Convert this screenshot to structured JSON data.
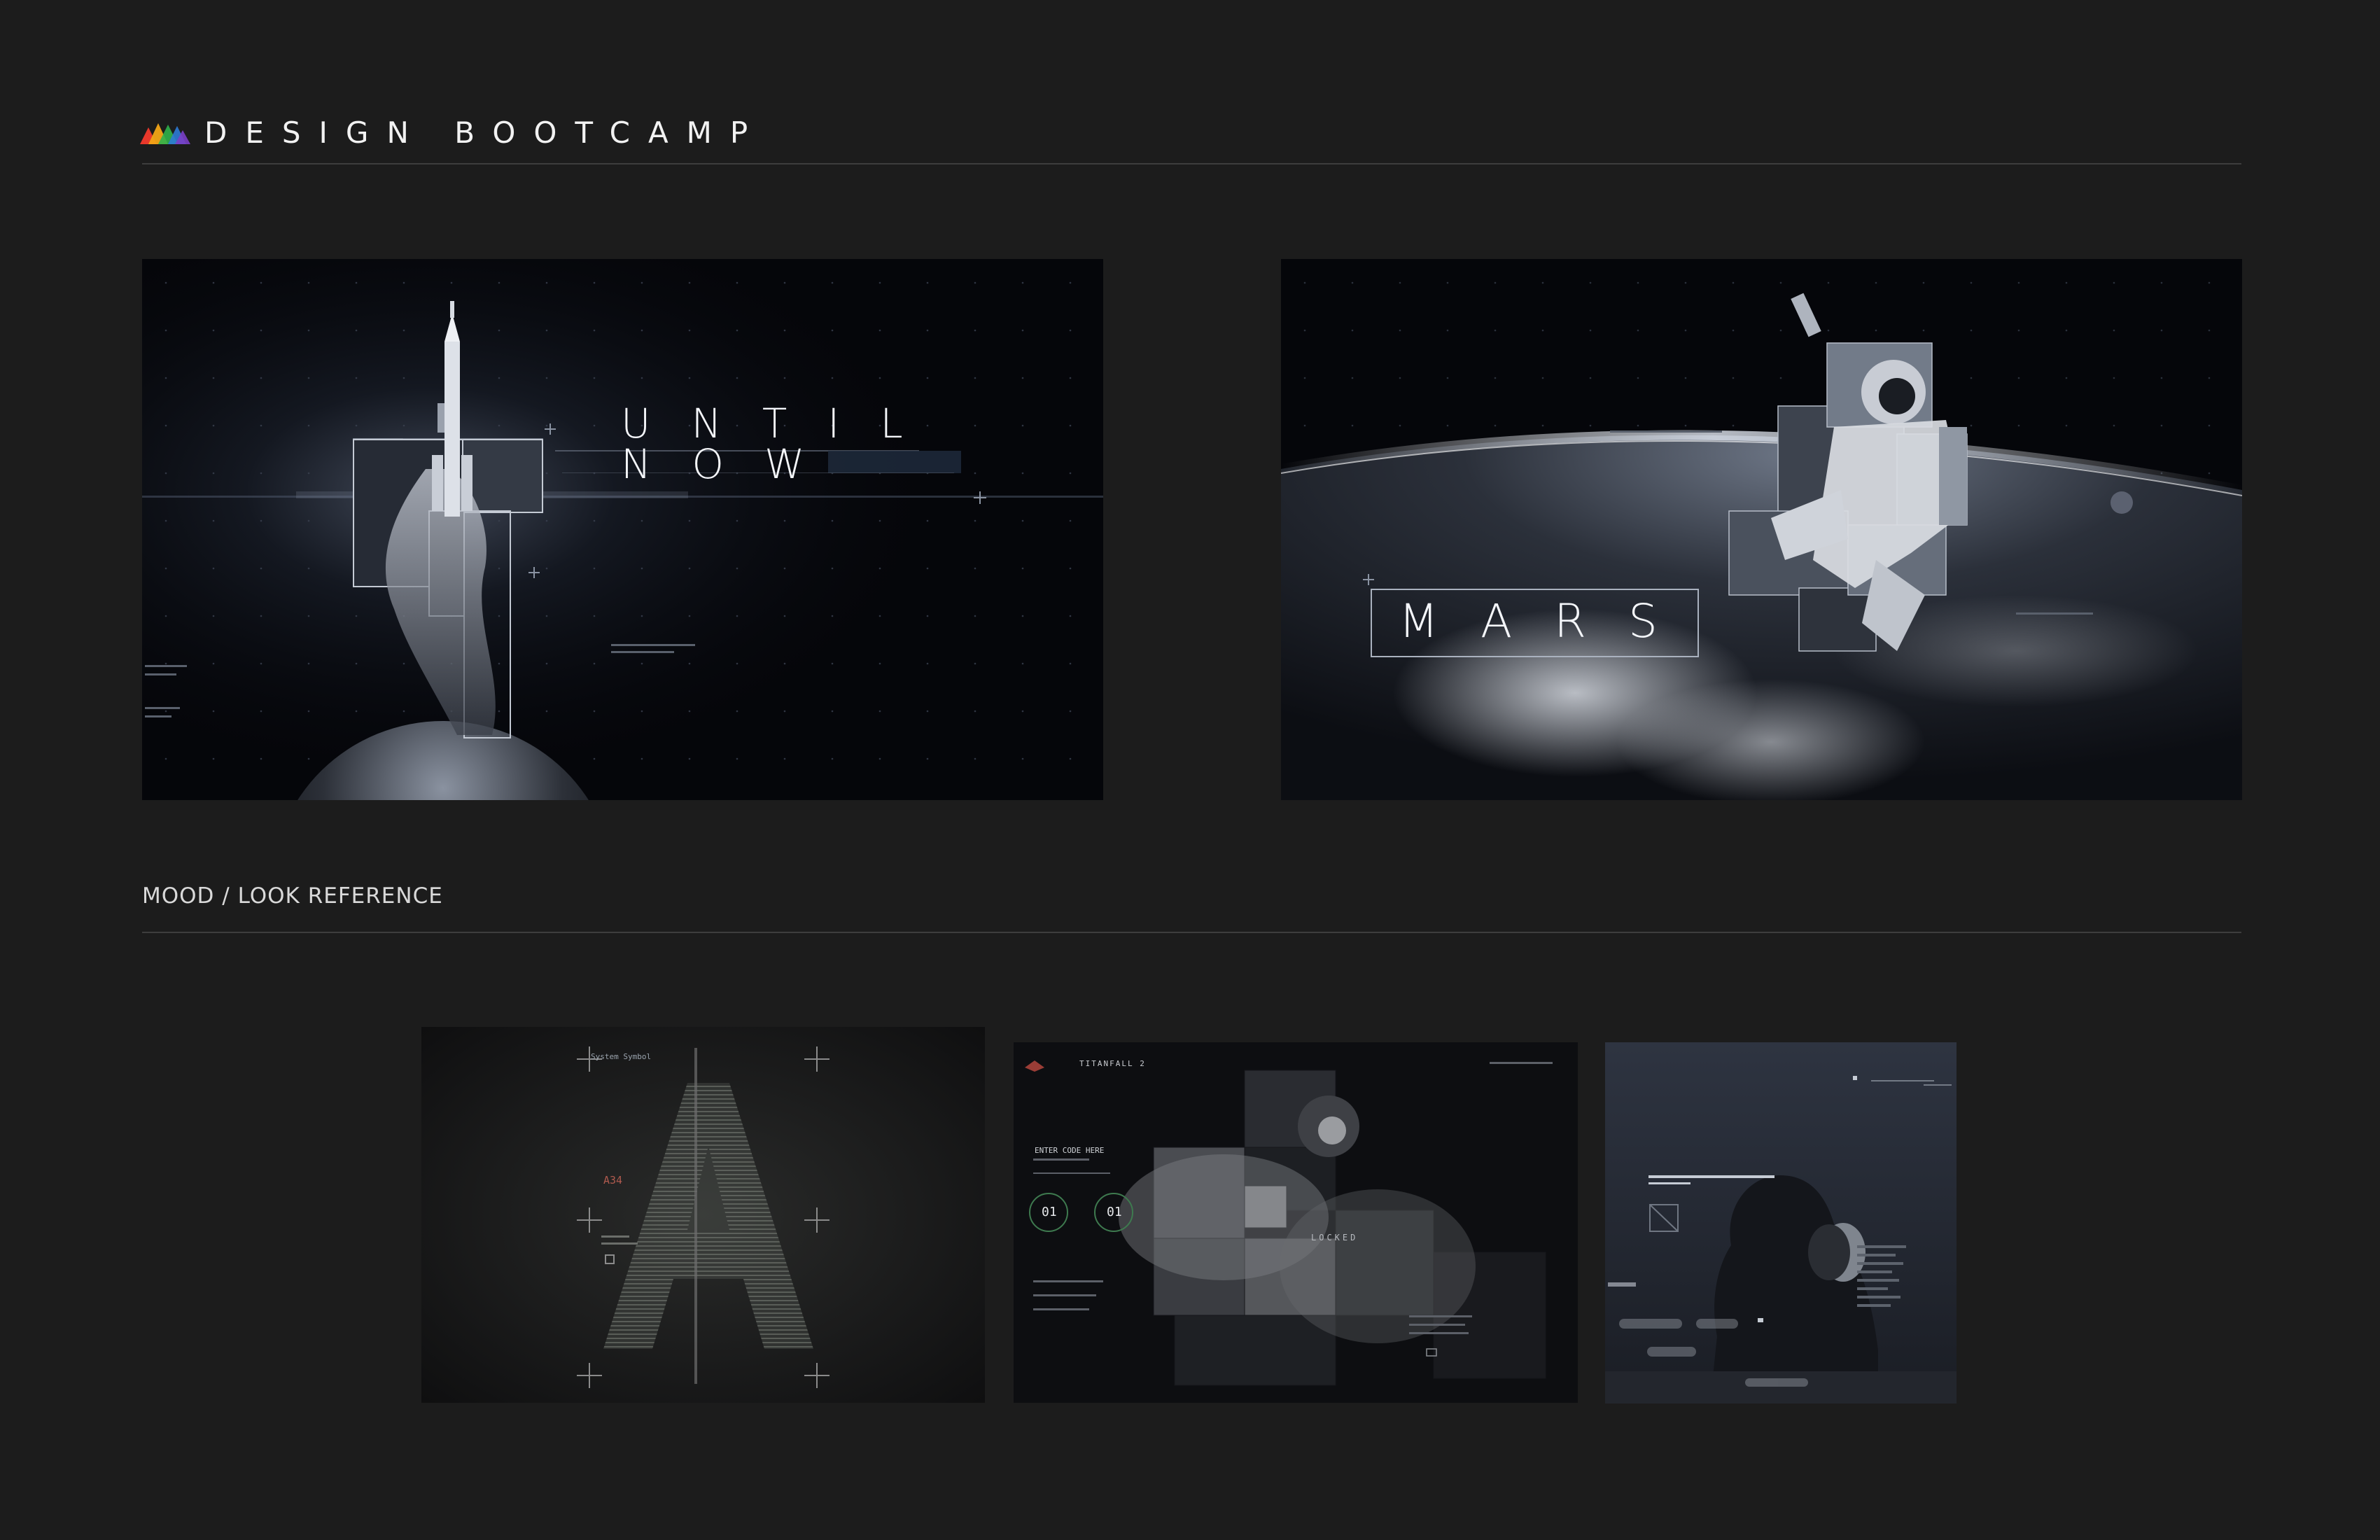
{
  "header": {
    "brand": "DESIGN BOOTCAMP",
    "logo_colors": [
      "#e8382b",
      "#f2a516",
      "#2fb24b",
      "#2e7bd6",
      "#7a3fc7"
    ]
  },
  "hero": {
    "left": {
      "line1": "UNTIL",
      "line2": "NOW"
    },
    "right": {
      "word": "MARS"
    }
  },
  "mood": {
    "title": "MOOD / LOOK REFERENCE",
    "thumb1": {
      "label_a": "A34",
      "label_b": "System Symbol"
    },
    "thumb2": {
      "brand": "TITANFALL 2",
      "prompt": "ENTER CODE HERE",
      "counter1": "01",
      "counter2": "01",
      "status": "LOCKED"
    }
  }
}
